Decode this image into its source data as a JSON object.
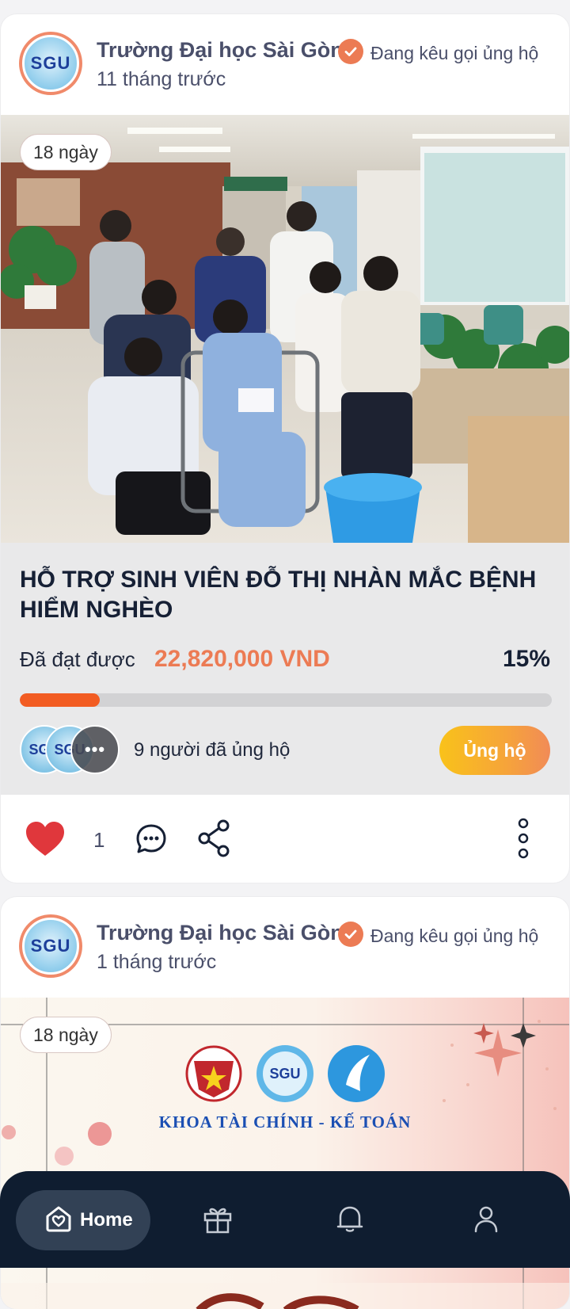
{
  "posts": [
    {
      "org_name": "Trường Đại học Sài Gòn",
      "status": "Đang kêu gọi ủng hộ",
      "time_ago": "11 tháng trước",
      "avatar_text": "SGU",
      "days_left": "18 ngày",
      "title": "HỖ TRỢ SINH VIÊN ĐỖ THỊ NHÀN MẮC BỆNH HIỂM NGHÈO",
      "raised_label": "Đã đạt được",
      "raised_amount": "22,820,000 VND",
      "percent_text": "15%",
      "progress_fraction": 0.15,
      "supporters_text": "9 người đã ủng hộ",
      "supporter_avatar_text": "SGU",
      "donate_label": "Ủng hộ",
      "like_count": "1"
    },
    {
      "org_name": "Trường Đại học Sài Gòn",
      "status": "Đang kêu gọi ủng hộ",
      "time_ago": "1 tháng trước",
      "avatar_text": "SGU",
      "days_left": "18 ngày",
      "banner_logo_text": "SGU",
      "banner_caption": "KHOA TÀI CHÍNH - KẾ TOÁN"
    }
  ],
  "nav": {
    "home_label": "Home",
    "items": [
      "home-icon",
      "gift-icon",
      "bell-icon",
      "profile-icon"
    ]
  },
  "colors": {
    "accent": "#ec7b54",
    "progress": "#f25c22",
    "nav_bg": "#0f1d30",
    "title": "#162035"
  }
}
